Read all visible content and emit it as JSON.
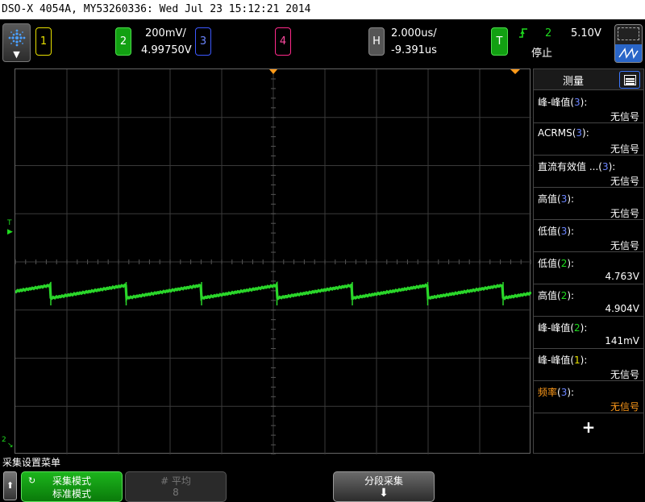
{
  "title_bar": "DSO-X 4054A, MY53260336: Wed Jul 23 15:12:21 2014",
  "channels": {
    "ch1": {
      "label": "1",
      "color": "#e8e000"
    },
    "ch2": {
      "label": "2",
      "scale": "200mV/",
      "offset": "4.99750V",
      "color": "#1fdc1f"
    },
    "ch3": {
      "label": "3",
      "color": "#3c58ff"
    },
    "ch4": {
      "label": "4",
      "color": "#ff2a8a"
    }
  },
  "horizontal": {
    "label": "H",
    "timebase": "2.000us/",
    "delay": "-9.391us"
  },
  "trigger": {
    "label": "T",
    "source": "2",
    "level": "5.10V",
    "status": "停止",
    "icon": "rising-edge-icon"
  },
  "markers": {
    "trigger_level": "T",
    "ground_ch2": "2"
  },
  "measurements": {
    "title": "测量",
    "items": [
      {
        "label": "峰-峰值",
        "ch": "3",
        "value": "无信号",
        "highlight": false
      },
      {
        "label": "ACRMS",
        "ch": "3",
        "value": "无信号",
        "highlight": false
      },
      {
        "label": "直流有效值 ...",
        "ch": "3",
        "value": "无信号",
        "highlight": false
      },
      {
        "label": "高值",
        "ch": "3",
        "value": "无信号",
        "highlight": false
      },
      {
        "label": "低值",
        "ch": "3",
        "value": "无信号",
        "highlight": false
      },
      {
        "label": "低值",
        "ch": "2",
        "value": "4.763V",
        "highlight": false
      },
      {
        "label": "高值",
        "ch": "2",
        "value": "4.904V",
        "highlight": false
      },
      {
        "label": "峰-峰值",
        "ch": "2",
        "value": "141mV",
        "highlight": false
      },
      {
        "label": "峰-峰值",
        "ch": "1",
        "value": "无信号",
        "highlight": false
      },
      {
        "label": "频率",
        "ch": "3",
        "value": "无信号",
        "highlight": true
      }
    ],
    "add_label": "+"
  },
  "softkeys": {
    "menu_title": "采集设置菜单",
    "acq_mode_label": "采集模式",
    "acq_mode_value": "标准模式",
    "averages_label": "# 平均",
    "averages_value": "8",
    "segmented_label": "分段采集"
  },
  "colors": {
    "ch_text": {
      "1": "#e8e000",
      "2": "#1fdc1f",
      "3": "#6c86ff"
    },
    "highlight": "#ff9a1a",
    "waveform": "#2ad62a"
  }
}
